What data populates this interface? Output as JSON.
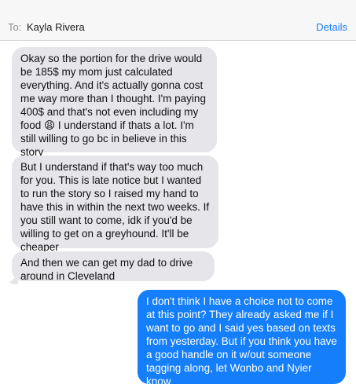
{
  "header": {
    "to_label": "To:",
    "recipient": "Kayla Rivera",
    "details_label": "Details"
  },
  "messages": [
    {
      "direction": "incoming",
      "text": "Okay so the portion for the drive would be 185$ my mom just calculated everything. And it's actually gonna cost me way more than I thought. I'm paying 400$ and that's not even including my food 😩  I understand if thats a lot. I'm still willing to go bc in believe in this story"
    },
    {
      "direction": "incoming",
      "text": "But I understand if that's way too much for you. This is late notice but I wanted to run the story so I raised my hand to have this in within the next two weeks. If you still want to come, idk if you'd be willing to get on a greyhound. It'll be cheaper"
    },
    {
      "direction": "incoming",
      "text": "And then we can get my dad to drive around in Cleveland"
    },
    {
      "direction": "outgoing",
      "text": "I don't think I have a choice not to come at this point? They already asked me if I want to go and I said yes based on texts from yesterday. But if you think you have a good handle on it w/out someone tagging along, let Wonbo and Nyier know"
    }
  ],
  "colors": {
    "incoming_bubble": "#e5e5ea",
    "outgoing_bubble": "#147efb",
    "accent": "#1a7ef7"
  }
}
